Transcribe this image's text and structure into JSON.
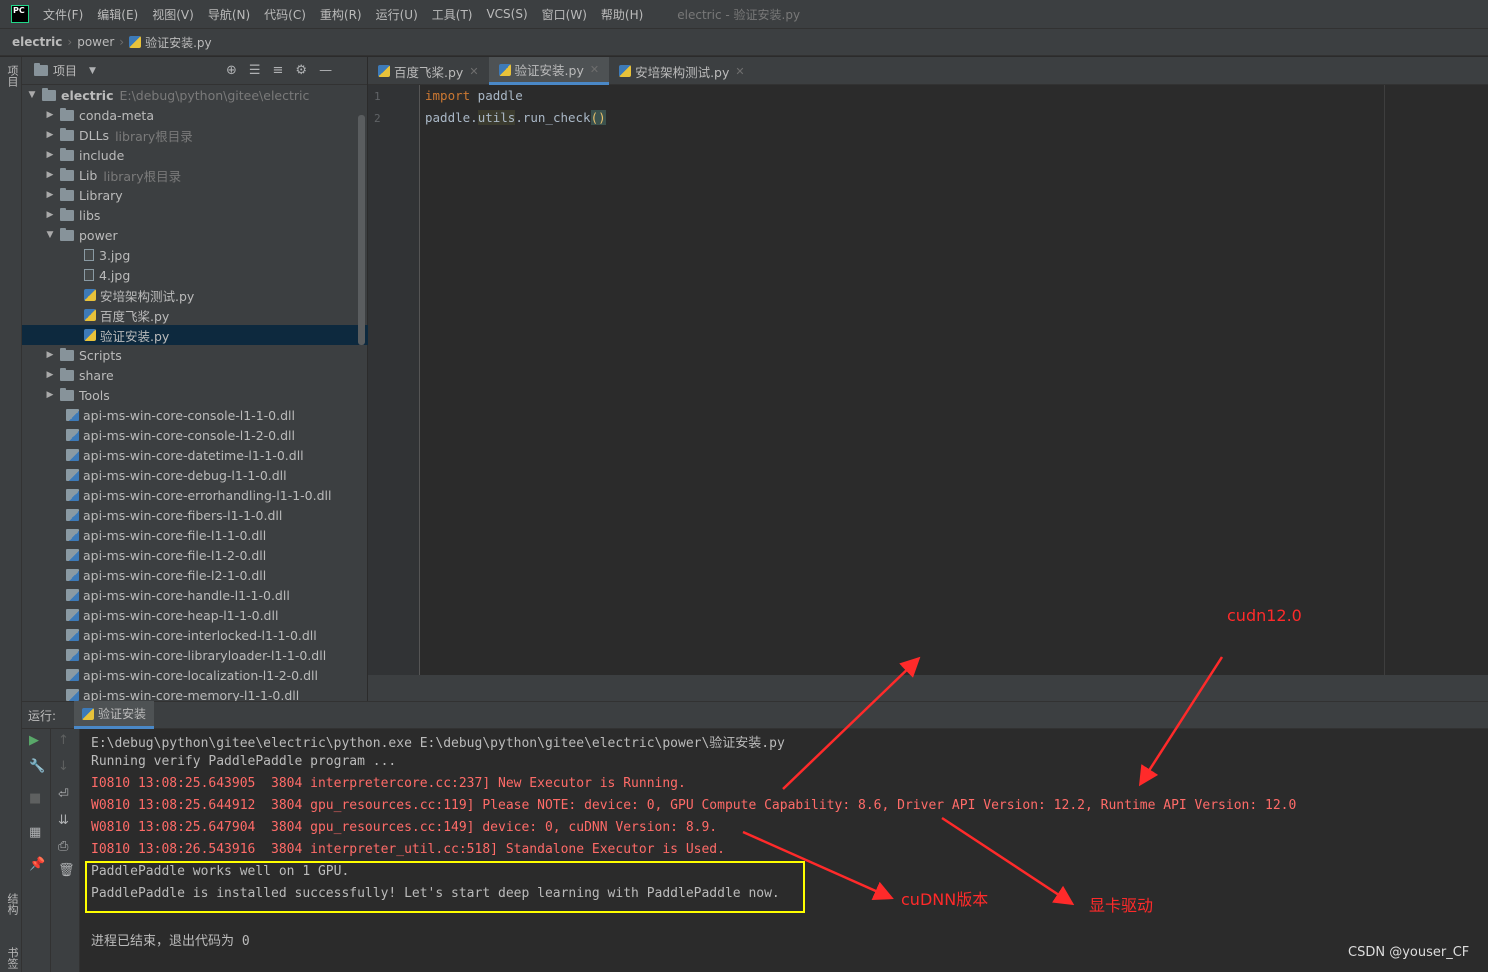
{
  "menubar": {
    "items": [
      "文件(F)",
      "编辑(E)",
      "视图(V)",
      "导航(N)",
      "代码(C)",
      "重构(R)",
      "运行(U)",
      "工具(T)",
      "VCS(S)",
      "窗口(W)",
      "帮助(H)"
    ],
    "window_title": "electric - 验证安装.py",
    "logo": "PC"
  },
  "breadcrumb": [
    "electric",
    "power",
    "验证安装.py"
  ],
  "left_strip": {
    "project": "项目",
    "structure": "结构",
    "bookmarks": "书签"
  },
  "project_panel": {
    "title": "项目",
    "root": {
      "name": "electric",
      "path": "E:\\debug\\python\\gitee\\electric"
    },
    "folders": [
      {
        "name": "conda-meta",
        "hint": ""
      },
      {
        "name": "DLLs",
        "hint": "library根目录"
      },
      {
        "name": "include",
        "hint": ""
      },
      {
        "name": "Lib",
        "hint": "library根目录"
      },
      {
        "name": "Library",
        "hint": ""
      },
      {
        "name": "libs",
        "hint": ""
      },
      {
        "name": "power",
        "hint": ""
      }
    ],
    "power_files": [
      "3.jpg",
      "4.jpg",
      "安培架构测试.py",
      "百度飞桨.py",
      "验证安装.py"
    ],
    "more_folders": [
      "Scripts",
      "share",
      "Tools"
    ],
    "dlls": [
      "api-ms-win-core-console-l1-1-0.dll",
      "api-ms-win-core-console-l1-2-0.dll",
      "api-ms-win-core-datetime-l1-1-0.dll",
      "api-ms-win-core-debug-l1-1-0.dll",
      "api-ms-win-core-errorhandling-l1-1-0.dll",
      "api-ms-win-core-fibers-l1-1-0.dll",
      "api-ms-win-core-file-l1-1-0.dll",
      "api-ms-win-core-file-l1-2-0.dll",
      "api-ms-win-core-file-l2-1-0.dll",
      "api-ms-win-core-handle-l1-1-0.dll",
      "api-ms-win-core-heap-l1-1-0.dll",
      "api-ms-win-core-interlocked-l1-1-0.dll",
      "api-ms-win-core-libraryloader-l1-1-0.dll",
      "api-ms-win-core-localization-l1-2-0.dll",
      "api-ms-win-core-memory-l1-1-0.dll"
    ]
  },
  "editor": {
    "tabs": [
      "百度飞桨.py",
      "验证安装.py",
      "安培架构测试.py"
    ],
    "active_tab": 1,
    "line_numbers": [
      "1",
      "2"
    ],
    "code": {
      "l1_kw": "import",
      "l1_rest": " paddle",
      "l2_a": "paddle.",
      "l2_b": "utils",
      "l2_c": ".run_check",
      "l2_d": "()"
    }
  },
  "run_panel": {
    "label": "运行:",
    "tab": "验证安装",
    "console": [
      {
        "text": "E:\\debug\\python\\gitee\\electric\\python.exe E:\\debug\\python\\gitee\\electric\\power\\验证安装.py",
        "err": false
      },
      {
        "text": "Running verify PaddlePaddle program ...",
        "err": false
      },
      {
        "text": "I0810 13:08:25.643905  3804 interpretercore.cc:237] New Executor is Running.",
        "err": true
      },
      {
        "text": "W0810 13:08:25.644912  3804 gpu_resources.cc:119] Please NOTE: device: 0, GPU Compute Capability: 8.6, Driver API Version: 12.2, Runtime API Version: 12.0",
        "err": true
      },
      {
        "text": "W0810 13:08:25.647904  3804 gpu_resources.cc:149] device: 0, cuDNN Version: 8.9.",
        "err": true
      },
      {
        "text": "I0810 13:08:26.543916  3804 interpreter_util.cc:518] Standalone Executor is Used.",
        "err": true
      },
      {
        "text": "PaddlePaddle works well on 1 GPU.",
        "err": false
      },
      {
        "text": "PaddlePaddle is installed successfully! Let's start deep learning with PaddlePaddle now.",
        "err": false
      },
      {
        "text": "",
        "err": false
      },
      {
        "text": "进程已结束，退出代码为 0",
        "err": false
      }
    ]
  },
  "annotations": {
    "cudn": "cudn12.0",
    "cudnn_version": "cuDNN版本",
    "driver": "显卡驱动",
    "color": "#ff2a2a",
    "highlight_color": "#ffff00"
  },
  "watermark": "CSDN @youser_CF"
}
